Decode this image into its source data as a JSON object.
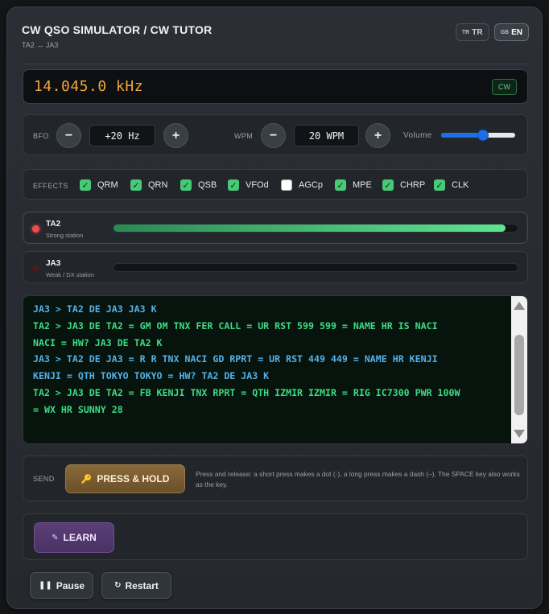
{
  "header": {
    "title": "CW QSO SIMULATOR / CW TUTOR",
    "subtitle": "TA2 ↔ JA3",
    "lang_buttons": [
      {
        "flag": "TR",
        "label": "TR",
        "active": false
      },
      {
        "flag": "GB",
        "label": "EN",
        "active": true
      }
    ]
  },
  "display": {
    "frequency": "14.045.0 kHz",
    "mode": "CW"
  },
  "controls": {
    "bfo_label": "BFO",
    "bfo_value": "+20 Hz",
    "wpm_label": "WPM",
    "wpm_value": "20 WPM",
    "minus": "−",
    "plus": "+",
    "volume_label": "Volume",
    "volume_level": 0.58
  },
  "effects": {
    "label": "EFFECTS",
    "items": [
      {
        "label": "QRM",
        "checked": true
      },
      {
        "label": "QRN",
        "checked": true
      },
      {
        "label": "QSB",
        "checked": true
      },
      {
        "label": "VFOd",
        "checked": true
      },
      {
        "label": "AGCp",
        "checked": false
      },
      {
        "label": "MPE",
        "checked": true
      },
      {
        "label": "CHRP",
        "checked": true
      },
      {
        "label": "CLK",
        "checked": true
      }
    ]
  },
  "stations": [
    {
      "name": "TA2",
      "desc": "Strong station",
      "active": true,
      "level": 0.97
    },
    {
      "name": "JA3",
      "desc": "Weak / DX station",
      "active": false,
      "level": 0
    }
  ],
  "log": {
    "lines": [
      {
        "who": "rx",
        "text": "JA3 > TA2 DE JA3 JA3 K"
      },
      {
        "who": "tx",
        "text": "TA2 > JA3 DE TA2 = GM OM TNX FER CALL = UR RST 599 599 = NAME HR IS NACI"
      },
      {
        "who": "tx",
        "text": "NACI = HW? JA3 DE TA2 K"
      },
      {
        "who": "rx",
        "text": "JA3 > TA2 DE JA3 = R R TNX NACI GD RPRT = UR RST 449 449 = NAME HR KENJI"
      },
      {
        "who": "rx",
        "text": "KENJI = QTH TOKYO TOKYO = HW? TA2 DE JA3 K"
      },
      {
        "who": "tx",
        "text": "TA2 > JA3 DE TA2 = FB KENJI TNX RPRT = QTH IZMIR IZMIR = RIG IC7300 PWR 100W"
      },
      {
        "who": "tx",
        "text": "= WX HR SUNNY 28"
      }
    ]
  },
  "send": {
    "label": "SEND",
    "button": "PRESS & HOLD",
    "help": "Press and release: a short press makes a dot (·), a long press makes a dash (–). The SPACE key also works as the key."
  },
  "learn": {
    "button": "LEARN"
  },
  "footer": {
    "pause": "Pause",
    "restart": "Restart"
  }
}
